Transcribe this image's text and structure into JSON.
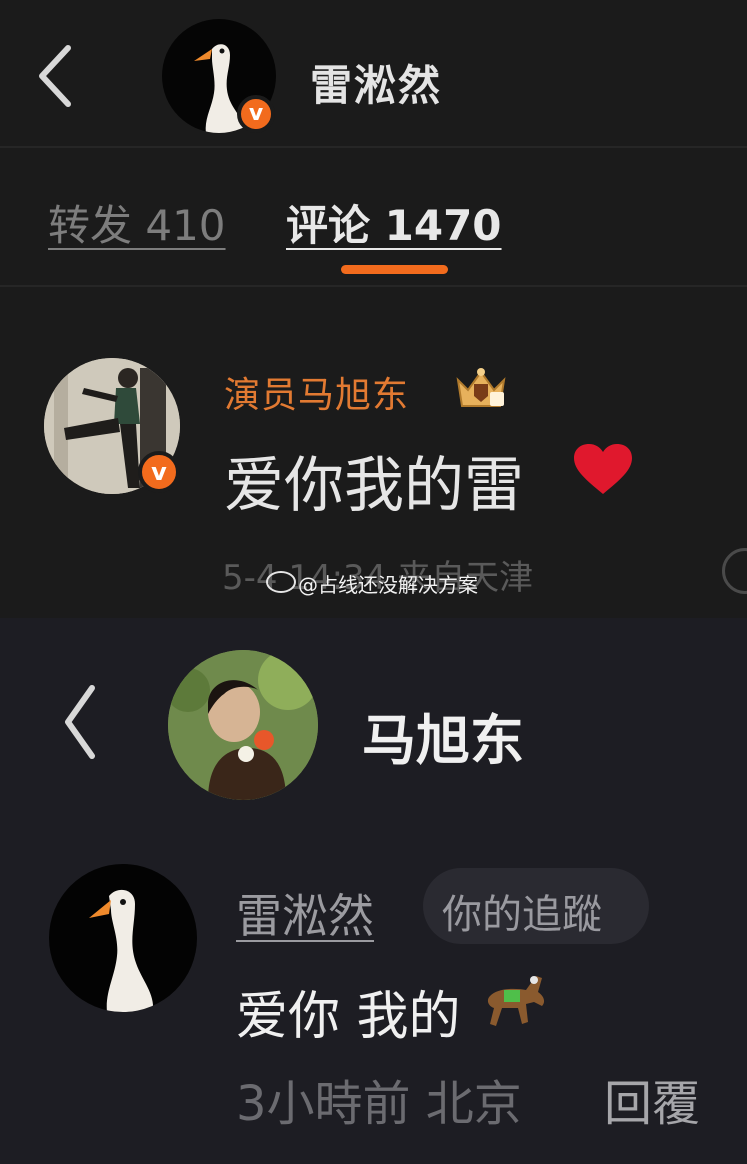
{
  "top": {
    "header_name": "雷淞然",
    "tabs": [
      {
        "label": "转发 410"
      },
      {
        "label": "评论 1470"
      }
    ],
    "comment": {
      "username": "演员马旭东",
      "text": "爱你我的雷",
      "meta": "5-4 14:34  来自天津"
    },
    "watermark": "@占线还没解决方案"
  },
  "bottom": {
    "header_name": "马旭东",
    "reply": {
      "username": "雷淞然",
      "tag": "你的追蹤",
      "text": "爱你 我的",
      "time_loc": "3小時前 北京",
      "reply_label": "回覆"
    }
  },
  "colors": {
    "accent": "#f26b1d",
    "username_orange": "#e27a32",
    "heart": "#e0182d"
  }
}
